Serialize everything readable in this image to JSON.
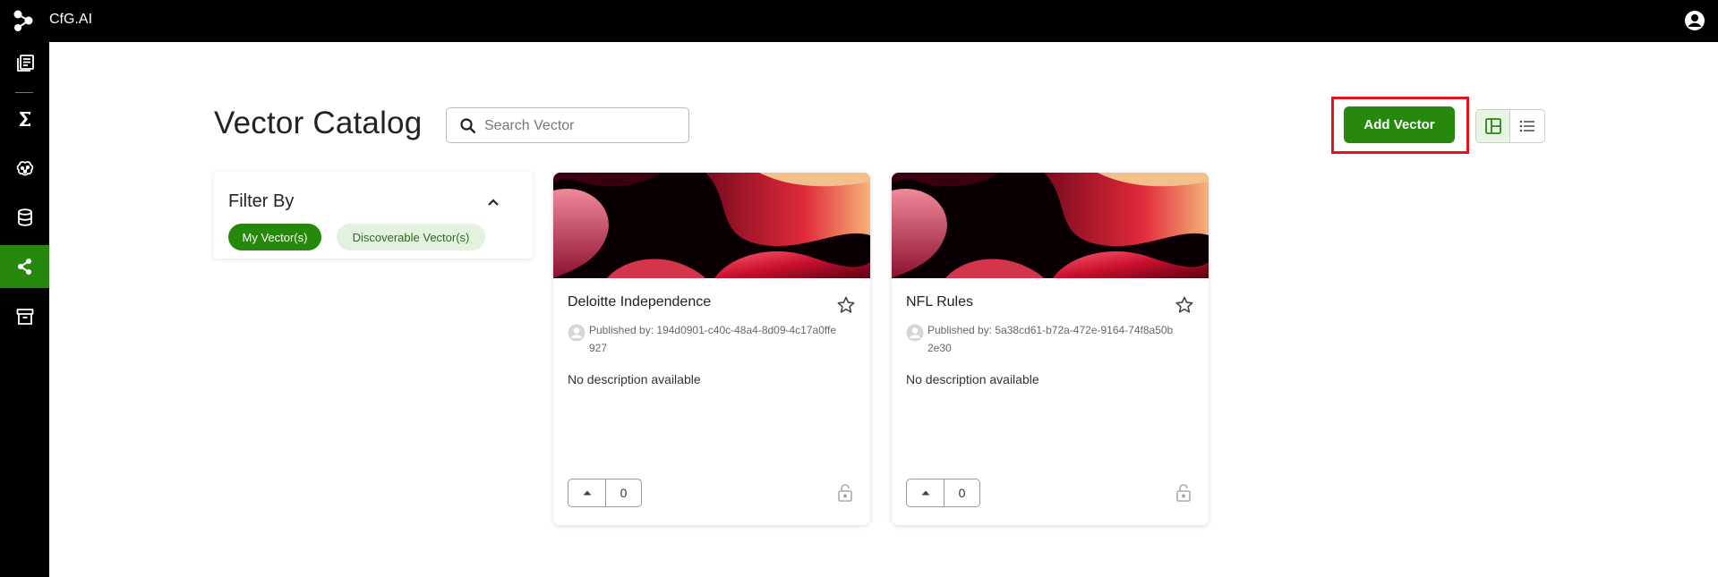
{
  "app": {
    "brand": "CfG.AI",
    "logo_icon": "network-nodes-icon",
    "account_icon": "account-circle-icon"
  },
  "sidebar": {
    "items": [
      {
        "icon": "library-books-icon",
        "active": false
      },
      {
        "icon": "sigma-icon",
        "active": false
      },
      {
        "icon": "brain-icon",
        "active": false
      },
      {
        "icon": "database-icon",
        "active": false
      },
      {
        "icon": "share-nodes-icon",
        "active": true
      },
      {
        "icon": "archive-box-icon",
        "active": false
      }
    ]
  },
  "header": {
    "title": "Vector Catalog",
    "search_placeholder": "Search Vector",
    "add_button_label": "Add Vector",
    "view_modes": [
      "grid-view-icon",
      "list-view-icon"
    ],
    "active_view": "grid"
  },
  "filter": {
    "title": "Filter By",
    "chips": [
      {
        "label": "My Vector(s)",
        "selected": true
      },
      {
        "label": "Discoverable Vector(s)",
        "selected": false
      }
    ]
  },
  "cards": [
    {
      "title": "Deloitte Independence",
      "publisher_prefix": "Published by:",
      "publisher": "194d0901-c40c-48a4-8d09-4c17a0ffe927",
      "description": "No description available",
      "votes": "0"
    },
    {
      "title": "NFL Rules",
      "publisher_prefix": "Published by:",
      "publisher": "5a38cd61-b72a-472e-9164-74f8a50b2e30",
      "description": "No description available",
      "votes": "0"
    }
  ],
  "colors": {
    "accent_green": "#26890d",
    "highlight_red": "#e0131f",
    "chip_light": "#e3f1df"
  }
}
